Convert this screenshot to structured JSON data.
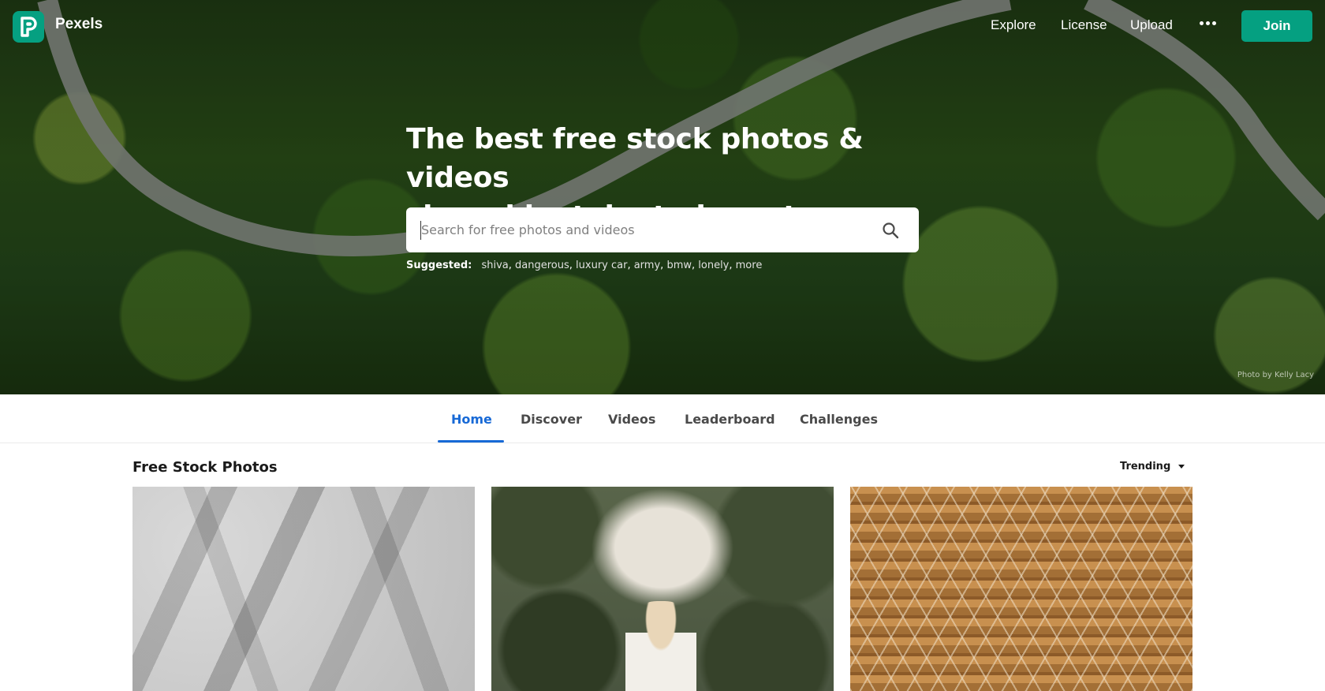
{
  "brand": {
    "name": "Pexels",
    "logo_letter": "P"
  },
  "nav": {
    "links": [
      "Explore",
      "License",
      "Upload"
    ],
    "more_icon": "more-dots-icon",
    "join_label": "Join"
  },
  "hero": {
    "headline_line1": "The best free stock photos & videos",
    "headline_line2": "shared by talented creators.",
    "search_placeholder": "Search for free photos and videos",
    "search_icon": "search-icon",
    "suggested_label": "Suggested:",
    "suggestions": [
      "shiva",
      "dangerous",
      "luxury car",
      "army",
      "bmw",
      "lonely",
      "more"
    ],
    "credit": "Photo by Kelly Lacy"
  },
  "tabs": [
    {
      "label": "Home",
      "active": true
    },
    {
      "label": "Discover",
      "active": false
    },
    {
      "label": "Videos",
      "active": false
    },
    {
      "label": "Leaderboard",
      "active": false
    },
    {
      "label": "Challenges",
      "active": false
    }
  ],
  "content": {
    "section_title": "Free Stock Photos",
    "sort_label": "Trending"
  },
  "colors": {
    "brand": "#05a081",
    "tab_active": "#1769d6"
  }
}
